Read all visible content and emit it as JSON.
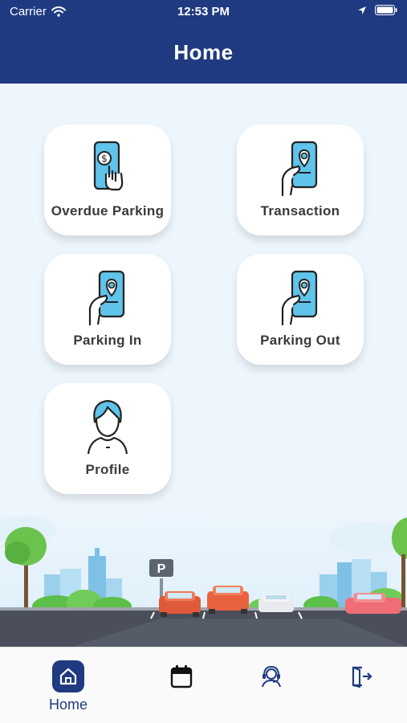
{
  "status_bar": {
    "carrier": "Carrier",
    "time": "12:53 PM"
  },
  "header": {
    "title": "Home"
  },
  "menu": [
    {
      "label": "Overdue Parking",
      "icon": "phone-payment-icon"
    },
    {
      "label": "Transaction",
      "icon": "phone-location-icon"
    },
    {
      "label": "Parking In",
      "icon": "phone-location-icon"
    },
    {
      "label": "Parking Out",
      "icon": "phone-location-icon"
    },
    {
      "label": "Profile",
      "icon": "user-icon"
    }
  ],
  "parking_sign": "P",
  "bottom_nav": [
    {
      "label": "Home",
      "icon": "home-icon",
      "active": true
    },
    {
      "label": "",
      "icon": "calendar-icon",
      "active": false
    },
    {
      "label": "",
      "icon": "support-agent-icon",
      "active": false
    },
    {
      "label": "",
      "icon": "logout-icon",
      "active": false
    }
  ],
  "colors": {
    "primary": "#1f3a80",
    "background": "#eef6fd",
    "accent": "#5fc3ea"
  }
}
